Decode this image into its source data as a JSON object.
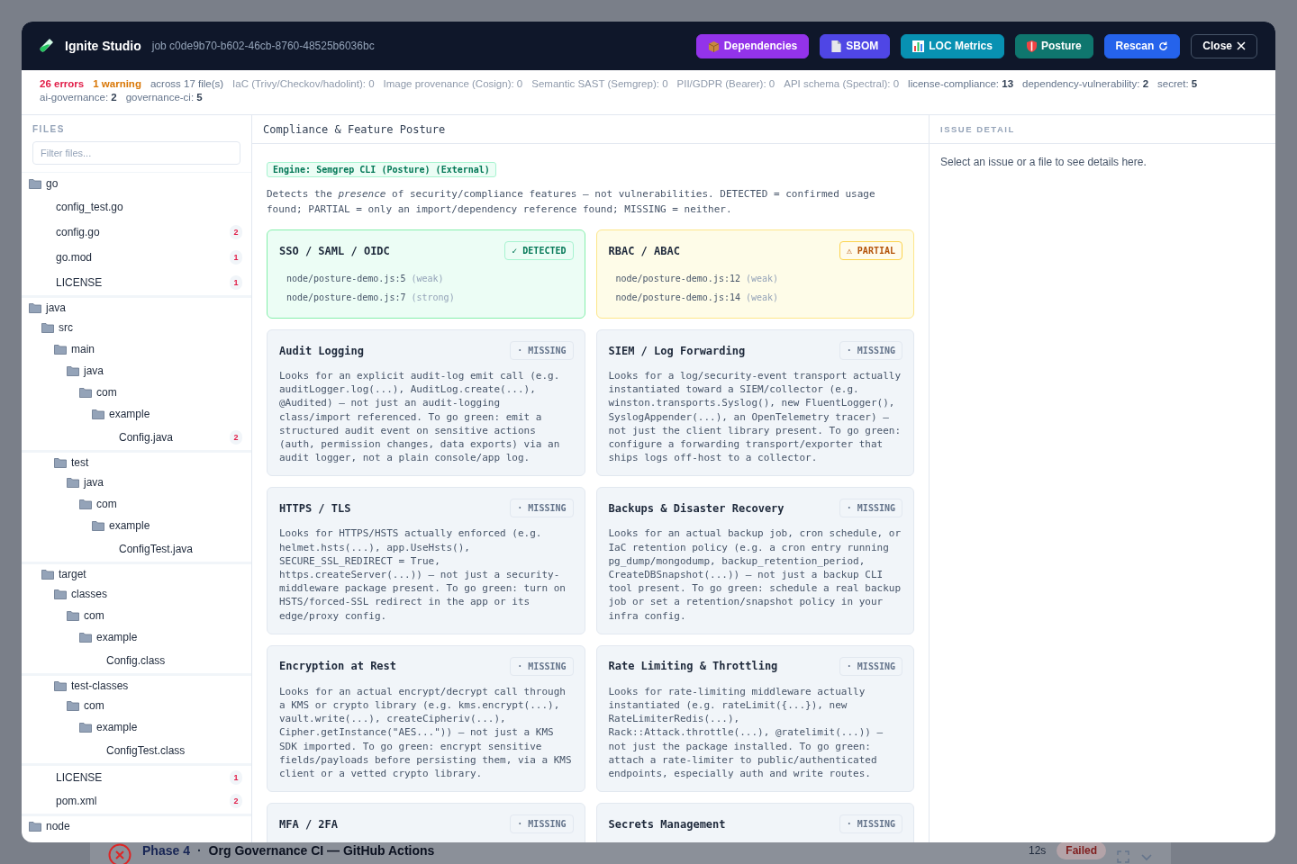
{
  "background": {
    "phase": "Phase 4",
    "separator": "·",
    "title": "Org Governance CI — GitHub Actions",
    "duration": "12s",
    "status": "Failed"
  },
  "window": {
    "title": "Ignite Studio",
    "job": "job c0de9b70-b602-46cb-8760-48525b6036bc",
    "buttons": [
      {
        "label": "Dependencies",
        "color": "#9333ea"
      },
      {
        "label": "SBOM",
        "color": "#4f46e5"
      },
      {
        "label": "LOC Metrics",
        "color": "#0891b2"
      },
      {
        "label": "Posture",
        "color": "#0f766e"
      },
      {
        "label": "Rescan",
        "color": "#2563eb"
      },
      {
        "label": "Close",
        "color": "#0f172a"
      }
    ]
  },
  "summary": [
    {
      "kind": "errors",
      "text": "26 errors"
    },
    {
      "kind": "warnings",
      "text": "1 warning"
    },
    {
      "kind": "note",
      "text": "across 17 file(s)"
    },
    {
      "kind": "stat",
      "label": "IaC (Trivy/Checkov/hadolint):",
      "count": "0",
      "muted": true
    },
    {
      "kind": "stat",
      "label": "Image provenance (Cosign):",
      "count": "0",
      "muted": true
    },
    {
      "kind": "stat",
      "label": "Semantic SAST (Semgrep):",
      "count": "0",
      "muted": true
    },
    {
      "kind": "stat",
      "label": "PII/GDPR (Bearer):",
      "count": "0",
      "muted": true
    },
    {
      "kind": "stat",
      "label": "API schema (Spectral):",
      "count": "0",
      "muted": true
    },
    {
      "kind": "stat",
      "label": "license-compliance:",
      "count": "13",
      "muted": false
    },
    {
      "kind": "stat",
      "label": "dependency-vulnerability:",
      "count": "2",
      "muted": false
    },
    {
      "kind": "stat",
      "label": "secret:",
      "count": "5",
      "muted": false
    },
    {
      "kind": "stat",
      "label": "ai-governance:",
      "count": "2",
      "muted": false
    },
    {
      "kind": "stat",
      "label": "governance-ci:",
      "count": "5",
      "muted": false
    }
  ],
  "files": {
    "heading": "FILES",
    "filter_placeholder": "Filter files...",
    "tree": [
      {
        "name": "go",
        "kind": "folder",
        "children": [
          {
            "name": "config_test.go",
            "kind": "file"
          },
          {
            "name": "config.go",
            "kind": "file",
            "count": "2"
          },
          {
            "name": "go.mod",
            "kind": "file",
            "count": "1"
          },
          {
            "name": "LICENSE",
            "kind": "file",
            "count": "1"
          }
        ]
      },
      {
        "name": "java",
        "kind": "folder",
        "children": [
          {
            "name": "src",
            "kind": "folder",
            "children": [
              {
                "name": "main",
                "kind": "folder",
                "children": [
                  {
                    "name": "java",
                    "kind": "folder",
                    "children": [
                      {
                        "name": "com",
                        "kind": "folder",
                        "children": [
                          {
                            "name": "example",
                            "kind": "folder",
                            "children": [
                              {
                                "name": "Config.java",
                                "kind": "file",
                                "count": "2"
                              }
                            ]
                          }
                        ]
                      }
                    ]
                  }
                ]
              },
              {
                "name": "test",
                "kind": "folder",
                "children": [
                  {
                    "name": "java",
                    "kind": "folder",
                    "children": [
                      {
                        "name": "com",
                        "kind": "folder",
                        "children": [
                          {
                            "name": "example",
                            "kind": "folder",
                            "children": [
                              {
                                "name": "ConfigTest.java",
                                "kind": "file"
                              }
                            ]
                          }
                        ]
                      }
                    ]
                  }
                ]
              }
            ]
          },
          {
            "name": "target",
            "kind": "folder",
            "children": [
              {
                "name": "classes",
                "kind": "folder",
                "children": [
                  {
                    "name": "com",
                    "kind": "folder",
                    "children": [
                      {
                        "name": "example",
                        "kind": "folder",
                        "children": [
                          {
                            "name": "Config.class",
                            "kind": "file"
                          }
                        ]
                      }
                    ]
                  }
                ]
              },
              {
                "name": "test-classes",
                "kind": "folder",
                "children": [
                  {
                    "name": "com",
                    "kind": "folder",
                    "children": [
                      {
                        "name": "example",
                        "kind": "folder",
                        "children": [
                          {
                            "name": "ConfigTest.class",
                            "kind": "file"
                          }
                        ]
                      }
                    ]
                  }
                ]
              }
            ]
          },
          {
            "name": "LICENSE",
            "kind": "file",
            "count": "1"
          },
          {
            "name": "pom.xml",
            "kind": "file",
            "count": "2"
          }
        ]
      },
      {
        "name": "node",
        "kind": "folder"
      }
    ]
  },
  "posture": {
    "title": "Compliance & Feature Posture",
    "engine": "Engine: Semgrep CLI (Posture) (External)",
    "description": "Detects the *presence* of security/compliance features — not vulnerabilities. DETECTED = confirmed usage found; PARTIAL = only an import/dependency reference found; MISSING = neither.",
    "cards": [
      {
        "title": "SSO / SAML / OIDC",
        "kind": "detected",
        "badge": "✓ DETECTED",
        "evidence": [
          {
            "location": "node/posture-demo.js:5",
            "strength": "(weak)"
          },
          {
            "location": "node/posture-demo.js:7",
            "strength": "(strong)"
          }
        ]
      },
      {
        "title": "RBAC / ABAC",
        "kind": "partial",
        "badge": "⚠ PARTIAL",
        "evidence": [
          {
            "location": "node/posture-demo.js:12",
            "strength": "(weak)"
          },
          {
            "location": "node/posture-demo.js:14",
            "strength": "(weak)"
          }
        ]
      },
      {
        "title": "Audit Logging",
        "kind": "missing",
        "badge": "· MISSING",
        "text": "Looks for an explicit audit-log emit call (e.g. auditLogger.log(...), AuditLog.create(...), @Audited) — not just an audit-logging class/import referenced. To go green: emit a structured audit event on sensitive actions (auth, permission changes, data exports) via an audit logger, not a plain console/app log."
      },
      {
        "title": "SIEM / Log Forwarding",
        "kind": "missing",
        "badge": "· MISSING",
        "text": "Looks for a log/security-event transport actually instantiated toward a SIEM/collector (e.g. winston.transports.Syslog(), new FluentLogger(), SyslogAppender(...), an OpenTelemetry tracer) — not just the client library present. To go green: configure a forwarding transport/exporter that ships logs off-host to a collector."
      },
      {
        "title": "HTTPS / TLS",
        "kind": "missing",
        "badge": "· MISSING",
        "text": "Looks for HTTPS/HSTS actually enforced (e.g. helmet.hsts(...), app.UseHsts(), SECURE_SSL_REDIRECT = True, https.createServer(...)) — not just a security-middleware package present. To go green: turn on HSTS/forced-SSL redirect in the app or its edge/proxy config."
      },
      {
        "title": "Backups & Disaster Recovery",
        "kind": "missing",
        "badge": "· MISSING",
        "text": "Looks for an actual backup job, cron schedule, or IaC retention policy (e.g. a cron entry running pg_dump/mongodump, backup_retention_period, CreateDBSnapshot(...)) — not just a backup CLI tool present. To go green: schedule a real backup job or set a retention/snapshot policy in your infra config."
      },
      {
        "title": "Encryption at Rest",
        "kind": "missing",
        "badge": "· MISSING",
        "text": "Looks for an actual encrypt/decrypt call through a KMS or crypto library (e.g. kms.encrypt(...), vault.write(...), createCipheriv(...), Cipher.getInstance(\"AES...\")) — not just a KMS SDK imported. To go green: encrypt sensitive fields/payloads before persisting them, via a KMS client or a vetted crypto library."
      },
      {
        "title": "Rate Limiting & Throttling",
        "kind": "missing",
        "badge": "· MISSING",
        "text": "Looks for rate-limiting middleware actually instantiated (e.g. rateLimit({...}), new RateLimiterRedis(...), Rack::Attack.throttle(...), @ratelimit(...)) — not just the package installed. To go green: attach a rate-limiter to public/authenticated endpoints, especially auth and write routes."
      },
      {
        "title": "MFA / 2FA",
        "kind": "missing",
        "badge": "· MISSING"
      },
      {
        "title": "Secrets Management",
        "kind": "missing",
        "badge": "· MISSING"
      }
    ]
  },
  "issue_detail": {
    "heading": "ISSUE DETAIL",
    "empty_text": "Select an issue or a file to see details here."
  }
}
